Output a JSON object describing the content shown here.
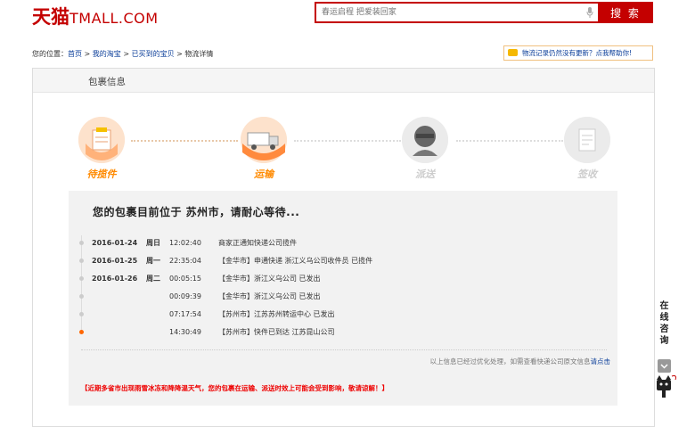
{
  "brand": {
    "cn": "天猫",
    "en": "TMALL.COM"
  },
  "search": {
    "placeholder": "春运启程 把爱装回家",
    "button": "搜 索"
  },
  "breadcrumb": {
    "prefix": "您的位置：",
    "items": [
      "首页",
      "我的淘宝",
      "已买到的宝贝",
      "物流详情"
    ],
    "sep": ">"
  },
  "help_link": "物流记录仍然没有更新？点我帮助你!",
  "panel_title": "包裹信息",
  "steps": [
    {
      "label": "待揽件",
      "state": "done",
      "color": "#ff8a00",
      "icon": "clipboard-icon"
    },
    {
      "label": "运输",
      "state": "current",
      "color": "#ff8a00",
      "icon": "truck-icon"
    },
    {
      "label": "派送",
      "state": "pending",
      "color": "#cccccc",
      "icon": "courier-icon"
    },
    {
      "label": "签收",
      "state": "pending",
      "color": "#cccccc",
      "icon": "signed-paper-icon"
    }
  ],
  "status_text": "您的包裹目前位于  苏州市，请耐心等待...",
  "tracking": [
    {
      "date": "2016-01-24",
      "weekday": "周日",
      "time": "12:02:40",
      "event": "商家正通知快递公司揽件"
    },
    {
      "date": "2016-01-25",
      "weekday": "周一",
      "time": "22:35:04",
      "event": "【金华市】申通快递 浙江义乌公司收件员 已揽件"
    },
    {
      "date": "2016-01-26",
      "weekday": "周二",
      "time": "00:05:15",
      "event": "【金华市】浙江义乌公司 已发出"
    },
    {
      "date": "",
      "weekday": "",
      "time": "00:09:39",
      "event": "【金华市】浙江义乌公司 已发出"
    },
    {
      "date": "",
      "weekday": "",
      "time": "07:17:54",
      "event": "【苏州市】江苏苏州转运中心 已发出"
    },
    {
      "date": "",
      "weekday": "",
      "time": "14:30:49",
      "event": "【苏州市】快件已到达 江苏昆山公司"
    }
  ],
  "optimized_note": "以上信息已经过优化处理，如需查看快递公司原文信息",
  "optimized_link": "请点击",
  "warning": "【近期多省市出现雨雪冰冻和降降温天气，您的包裹在运输、派送时效上可能会受到影响，敬请谅解！】",
  "side_consult": [
    "在",
    "线",
    "咨",
    "询"
  ],
  "colors": {
    "brand": "#c40000",
    "accent": "#ff8a00",
    "inactive": "#cccccc"
  }
}
